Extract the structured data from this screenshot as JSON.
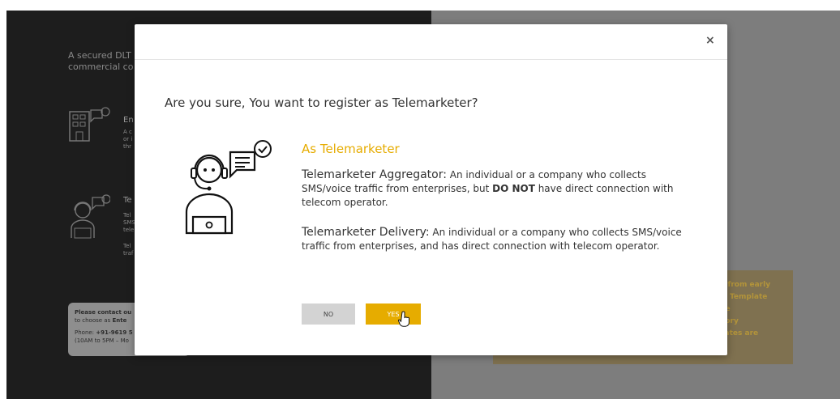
{
  "background": {
    "intro_line1": "A secured DLT p",
    "intro_line2": "commercial co",
    "enterprise": {
      "heading": "En",
      "desc_line1": "A c",
      "desc_line2": "or i",
      "desc_line3": "thr"
    },
    "telemarketer": {
      "heading": "Te",
      "desc_line1": "Tel",
      "desc_line2": "SMS",
      "desc_line3": "tele",
      "desc_line4": "Tel",
      "desc_line5": "traf"
    },
    "contact_box": {
      "line1": "Please contact ou",
      "line2_prefix": "to choose as ",
      "line2_strong": "Ente",
      "line3_prefix": "Phone: ",
      "line3_strong": "+91-9619 5",
      "line4": "(10AM to 5PM – Mo"
    },
    "notice_lines": [
      "ry from early",
      "nd Template",
      "are",
      "atory",
      "plates are"
    ]
  },
  "modal": {
    "close_symbol": "×",
    "title": "Are you sure, You want to register as Telemarketer?",
    "subheading": "As Telemarketer",
    "aggregator_term": "Telemarketer Aggregator:",
    "aggregator_desc_1": " An individual or a company who collects SMS/voice traffic from enterprises, but ",
    "aggregator_desc_bold": "DO NOT",
    "aggregator_desc_2": " have direct connection with telecom operator.",
    "delivery_term": "Telemarketer Delivery:",
    "delivery_desc": " An individual or a company who collects SMS/voice traffic from enterprises, and has direct connection with telecom operator.",
    "no_label": "NO",
    "yes_label": "YES"
  },
  "colors": {
    "accent": "#e6ac00",
    "dark_panel": "#1d1d1d",
    "overlay_gray": "#7d7d7d"
  }
}
